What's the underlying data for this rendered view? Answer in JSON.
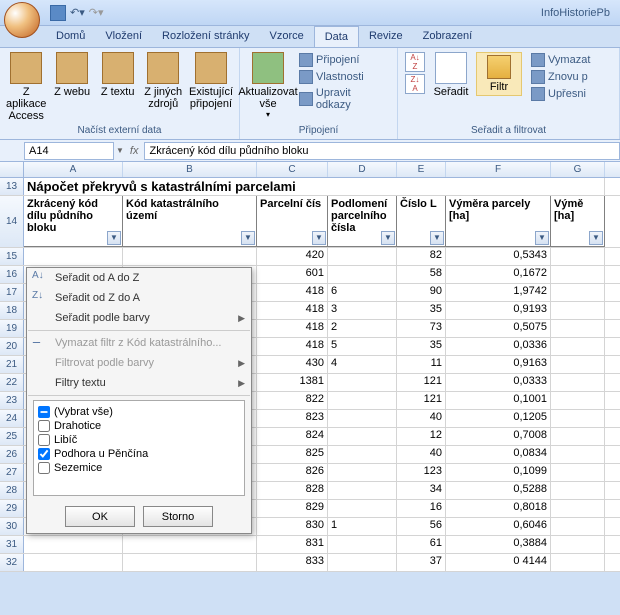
{
  "title": "InfoHistoriePb",
  "tabs": [
    "Domů",
    "Vložení",
    "Rozložení stránky",
    "Vzorce",
    "Data",
    "Revize",
    "Zobrazení"
  ],
  "activeTab": 4,
  "ribbon": {
    "g1": {
      "label": "Načíst externí data",
      "btns": [
        "Z aplikace Access",
        "Z webu",
        "Z textu",
        "Z jiných zdrojů",
        "Existující připojení"
      ]
    },
    "g2": {
      "label": "Připojení",
      "btn": "Aktualizovat vše",
      "items": [
        "Připojení",
        "Vlastnosti",
        "Upravit odkazy"
      ]
    },
    "g3": {
      "label": "Seřadit a filtrovat",
      "sort": "Seřadit",
      "filter": "Filtr",
      "items": [
        "Vymazat",
        "Znovu p",
        "Upřesni"
      ]
    }
  },
  "nameBox": "A14",
  "formula": "Zkrácený kód dílu půdního bloku",
  "cols": [
    "A",
    "B",
    "C",
    "D",
    "E",
    "F",
    "G"
  ],
  "titleCell": "Nápočet překryvů s katastrálními parcelami",
  "headers": [
    "Zkrácený kód dílu půdního bloku",
    "Kód katastrálního území",
    "Parcelní čís",
    "Podlomení parcelního čísla",
    "Číslo L",
    "Výměra parcely [ha]",
    "Výmě [ha]"
  ],
  "rows": [
    {
      "n": 15,
      "c": [
        "420",
        "",
        "82",
        "0,5343"
      ]
    },
    {
      "n": 16,
      "c": [
        "601",
        "",
        "58",
        "0,1672"
      ]
    },
    {
      "n": 17,
      "c": [
        "418",
        "6",
        "90",
        "1,9742"
      ]
    },
    {
      "n": 18,
      "c": [
        "418",
        "3",
        "35",
        "0,9193"
      ]
    },
    {
      "n": 19,
      "c": [
        "418",
        "2",
        "73",
        "0,5075"
      ]
    },
    {
      "n": 20,
      "c": [
        "418",
        "5",
        "35",
        "0,0336"
      ]
    },
    {
      "n": 21,
      "c": [
        "430",
        "4",
        "11",
        "0,9163"
      ]
    },
    {
      "n": 22,
      "c": [
        "1381",
        "",
        "121",
        "0,0333"
      ]
    },
    {
      "n": 23,
      "c": [
        "822",
        "",
        "121",
        "0,1001"
      ]
    },
    {
      "n": 24,
      "c": [
        "823",
        "",
        "40",
        "0,1205"
      ]
    },
    {
      "n": 25,
      "c": [
        "824",
        "",
        "12",
        "0,7008"
      ]
    },
    {
      "n": 26,
      "c": [
        "825",
        "",
        "40",
        "0,0834"
      ]
    },
    {
      "n": 27,
      "c": [
        "826",
        "",
        "123",
        "0,1099"
      ]
    },
    {
      "n": 28,
      "c": [
        "828",
        "",
        "34",
        "0,5288"
      ]
    },
    {
      "n": 29,
      "c": [
        "829",
        "",
        "16",
        "0,8018"
      ]
    },
    {
      "n": 30,
      "c": [
        "830",
        "1",
        "56",
        "0,6046"
      ]
    },
    {
      "n": 31,
      "c": [
        "831",
        "",
        "61",
        "0,3884"
      ]
    },
    {
      "n": 32,
      "c": [
        "833",
        "",
        "37",
        "0 4144"
      ]
    }
  ],
  "menu": {
    "sortAZ": "Seřadit od A do Z",
    "sortZA": "Seřadit od Z do A",
    "sortColor": "Seřadit podle barvy",
    "clear": "Vymazat filtr z Kód katastrálního...",
    "filterColor": "Filtrovat podle barvy",
    "filterText": "Filtry textu",
    "options": [
      {
        "label": "(Vybrat vše)",
        "checked": true,
        "mixed": true
      },
      {
        "label": "Drahotice",
        "checked": false
      },
      {
        "label": "Libíč",
        "checked": false
      },
      {
        "label": "Podhora u Pěnčína",
        "checked": true
      },
      {
        "label": "Sezemice",
        "checked": false
      }
    ],
    "ok": "OK",
    "cancel": "Storno"
  }
}
